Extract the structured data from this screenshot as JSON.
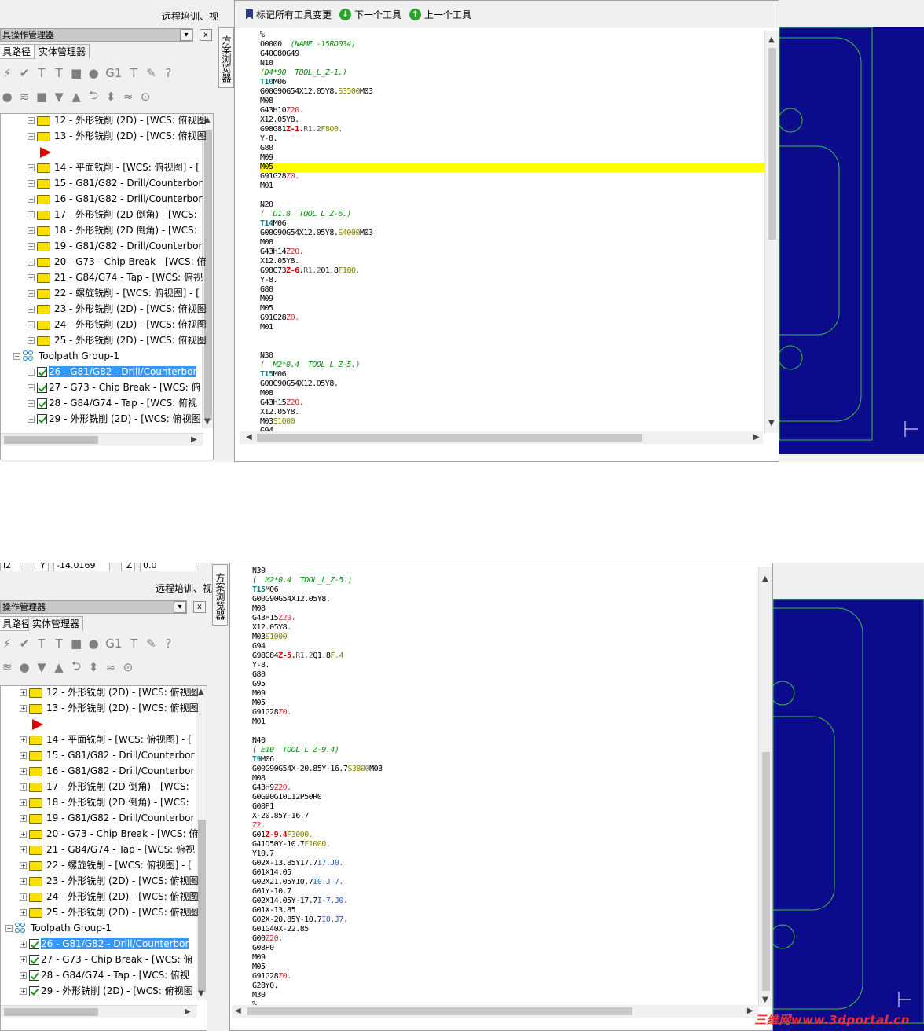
{
  "app": {
    "title_fragment": "远程培训、视",
    "manager_title_top": "具操作管理器",
    "manager_title_bottom": "操作管理器",
    "close_label": "x",
    "pin_label": "▾"
  },
  "tabs": {
    "toolpaths_top": "具路径",
    "toolpaths_bottom": "具路径",
    "solids": "实体管理器"
  },
  "toolbar_icons": [
    "checkmark-icon",
    "select-all-icon",
    "regen-icon",
    "regen-dirty-icon",
    "simulate-icon",
    "backplot-icon",
    "g1-icon",
    "post-icon",
    "lock-icon",
    "help-icon"
  ],
  "toolbar_g1_label": "G1",
  "toolbar_help_label": "?",
  "vertical_tab": "方案浏览器",
  "tree": {
    "items": [
      {
        "label": "12 - 外形铣削 (2D) - [WCS: 俯视图"
      },
      {
        "label": "13 - 外形铣削 (2D) - [WCS: 俯视图"
      },
      {
        "label": "14 - 平面铣削 - [WCS: 俯视图] - ["
      },
      {
        "label": "15 - G81/G82 - Drill/Counterbor"
      },
      {
        "label": "16 - G81/G82 - Drill/Counterbor"
      },
      {
        "label": "17 - 外形铣削 (2D 倒角) - [WCS: "
      },
      {
        "label": "18 - 外形铣削 (2D 倒角) - [WCS: "
      },
      {
        "label": "19 - G81/G82 - Drill/Counterbor"
      },
      {
        "label": "20 - G73 - Chip Break - [WCS: 俯"
      },
      {
        "label": "21 - G84/G74 - Tap - [WCS: 俯视"
      },
      {
        "label": "22 - 螺旋铣削 - [WCS: 俯视图] - ["
      },
      {
        "label": "23 - 外形铣削 (2D) - [WCS: 俯视图"
      },
      {
        "label": "24 - 外形铣削 (2D) - [WCS: 俯视图"
      },
      {
        "label": "25 - 外形铣削 (2D) - [WCS: 俯视图"
      }
    ],
    "group_label": "Toolpath Group-1",
    "group_items": [
      {
        "label": "26 - G81/G82 - Drill/Counterbor",
        "selected": true
      },
      {
        "label": "27 - G73 - Chip Break - [WCS: 俯",
        "selected": false
      },
      {
        "label": "28 - G84/G74 - Tap - [WCS: 俯视",
        "selected": false
      },
      {
        "label": "29 - 外形铣削 (2D) - [WCS: 俯视图",
        "selected": false
      }
    ]
  },
  "editor_toolbar": {
    "mark_all": "标记所有工具变更",
    "next_tool": "下一个工具",
    "prev_tool": "上一个工具"
  },
  "coords": {
    "z_label_left": "l2",
    "y_label": "Y",
    "y_value": "-14.0169",
    "z_label": "Z",
    "z_value": "0.0"
  },
  "nc_top": [
    "%",
    "O0000  (NAME -15RD034)",
    "G40G80G49",
    "N10",
    "(D4*90  TOOL_L_Z-1.)",
    "T10M06",
    "G00G90G54X12.05Y8.S3500M03",
    "M08",
    "G43H10Z20.",
    "X12.05Y8.",
    "G98G81Z-1.R1.2F800.",
    "Y-8.",
    "G80",
    "M09",
    "M05",
    "G91G28Z0.",
    "M01",
    "",
    "N20",
    "(  D1.8  TOOL_L_Z-6.)",
    "T14M06",
    "G00G90G54X12.05Y8.S4000M03",
    "M08",
    "G43H14Z20.",
    "X12.05Y8.",
    "G98G73Z-6.R1.2Q1.8F180.",
    "Y-8.",
    "G80",
    "M09",
    "M05",
    "G91G28Z0.",
    "M01",
    "",
    "",
    "N30",
    "(  M2*0.4  TOOL_L_Z-5.)",
    "T15M06",
    "G00G90G54X12.05Y8.",
    "M08",
    "G43H15Z20.",
    "X12.05Y8.",
    "M03S1000",
    "G94",
    "G98G84Z-5.R1.2Q1.8F.4"
  ],
  "nc_top_highlight_line": "M05",
  "nc_bottom": [
    "N30",
    "(  M2*0.4  TOOL_L_Z-5.)",
    "T15M06",
    "G00G90G54X12.05Y8.",
    "M08",
    "G43H15Z20.",
    "X12.05Y8.",
    "M03S1000",
    "G94",
    "G98G84Z-5.R1.2Q1.8F.4",
    "Y-8.",
    "G80",
    "G95",
    "M09",
    "M05",
    "G91G28Z0.",
    "M01",
    "",
    "N40",
    "( E10  TOOL_L_Z-9.4)",
    "T9M06",
    "G00G90G54X-20.85Y-16.7S3800M03",
    "M08",
    "G43H9Z20.",
    "G0G90G10L12P50R0",
    "G08P1",
    "X-20.85Y-16.7",
    "Z2.",
    "G01Z-9.4F3000.",
    "G41D50Y-10.7F1000.",
    "Y10.7",
    "G02X-13.85Y17.7I7.J0.",
    "G01X14.05",
    "G02X21.05Y10.7I0.J-7.",
    "G01Y-10.7",
    "G02X14.05Y-17.7I-7.J0.",
    "G01X-13.85",
    "G02X-20.85Y-10.7I0.J7.",
    "G01G40X-22.85",
    "G00Z20.",
    "G08P0",
    "M09",
    "M05",
    "G91G28Z0.",
    "G28Y0.",
    "M30",
    "%"
  ],
  "watermark": "三维网www.3dportal.cn",
  "colors": {
    "viewport_bg": "#0b0b8c",
    "geometry": "#3fbf3f",
    "selection": "#3399ff",
    "highlight": "#ffff00"
  }
}
